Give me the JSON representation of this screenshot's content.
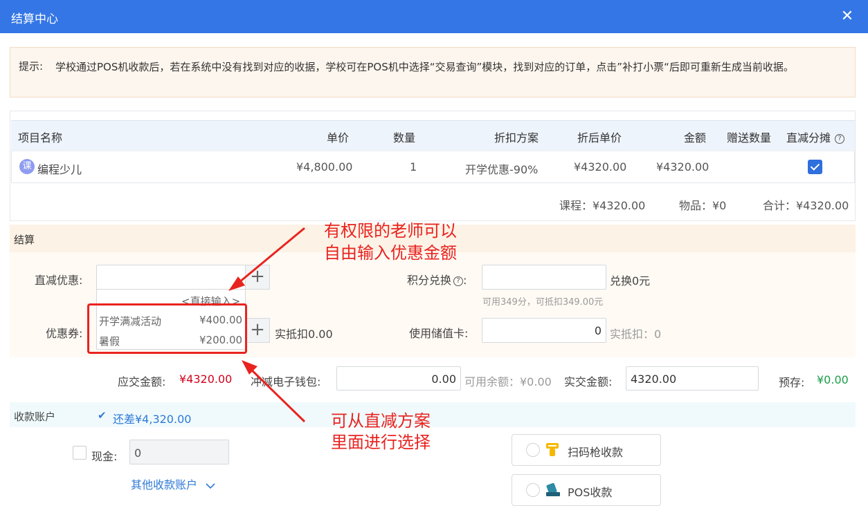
{
  "header": {
    "title": "结算中心",
    "close": "✕"
  },
  "notice": {
    "label": "提示:",
    "text": "学校通过POS机收款后，若在系统中没有找到对应的收据，学校可在POS机中选择“交易查询”模块，找到对应的订单，点击”补打小票“后即可重新生成当前收据。"
  },
  "table": {
    "headers": {
      "name": "项目名称",
      "price": "单价",
      "qty": "数量",
      "discount": "折扣方案",
      "after_price": "折后单价",
      "amount": "金额",
      "gift": "赠送数量",
      "direct_share": "直减分摊"
    },
    "help_glyph": "?",
    "row": {
      "badge": "课",
      "name": "编程少儿",
      "price": "¥4,800.00",
      "qty": "1",
      "discount": "开学优惠-90%",
      "after_price": "¥4320.00",
      "amount": "¥4320.00",
      "gift": ""
    },
    "summary": {
      "course": "课程：¥4320.00",
      "goods": "物品：¥0",
      "total": "合计：¥4320.00"
    }
  },
  "settlement": {
    "title": "结算",
    "direct_label": "直减优惠:",
    "direct_value": "",
    "plus": "+",
    "dropdown": {
      "direct_input": "<直接输入>",
      "options": [
        {
          "name": "开学满减活动",
          "amount": "¥400.00"
        },
        {
          "name": "暑假",
          "amount": "¥200.00"
        }
      ]
    },
    "coupon_label": "优惠券:",
    "coupon_deduct": "实抵扣0.00",
    "points_label": "积分兑换",
    "points_suffix": "兑换0元",
    "points_hint": "可用349分，可抵扣349.00元",
    "stored_label": "使用储值卡:",
    "stored_value": "0",
    "stored_deduct": "实抵扣：0",
    "due_label": "应交金额:",
    "due_value": "¥4320.00",
    "wallet_label": "冲减电子钱包:",
    "wallet_value": "0.00",
    "wallet_balance": "可用余额：¥0.00",
    "paid_label": "实交金额:",
    "paid_value": "4320.00",
    "prestore_label": "预存:",
    "prestore_value": "¥0.00"
  },
  "annotations": {
    "top": [
      "有权限的老师可以",
      "自由输入优惠金额"
    ],
    "bottom": [
      "可从直减方案",
      "里面进行选择"
    ]
  },
  "collection": {
    "title": "收款账户",
    "owed": "还差¥4,320.00",
    "cash_label": "现金:",
    "cash_value": "0",
    "other_accounts": "其他收款账户",
    "scan_label": "扫码枪收款",
    "pos_label": "POS收款"
  },
  "colors": {
    "header": "#3476e6",
    "annotation": "#e8231f",
    "due": "#d0021b",
    "prestore": "#1a9e4b"
  }
}
